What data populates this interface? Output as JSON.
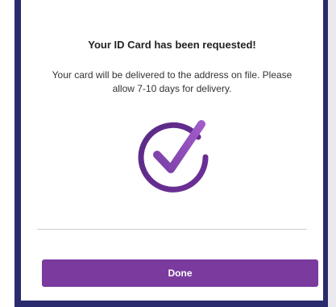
{
  "modal": {
    "title": "Your ID Card has been requested!",
    "message": "Your card will be delivered to the address on file. Please allow 7-10 days for delivery.",
    "icon": "check-circle-icon",
    "done_label": "Done"
  },
  "colors": {
    "accent": "#7a3a9e",
    "frame": "#2a2a6e"
  }
}
